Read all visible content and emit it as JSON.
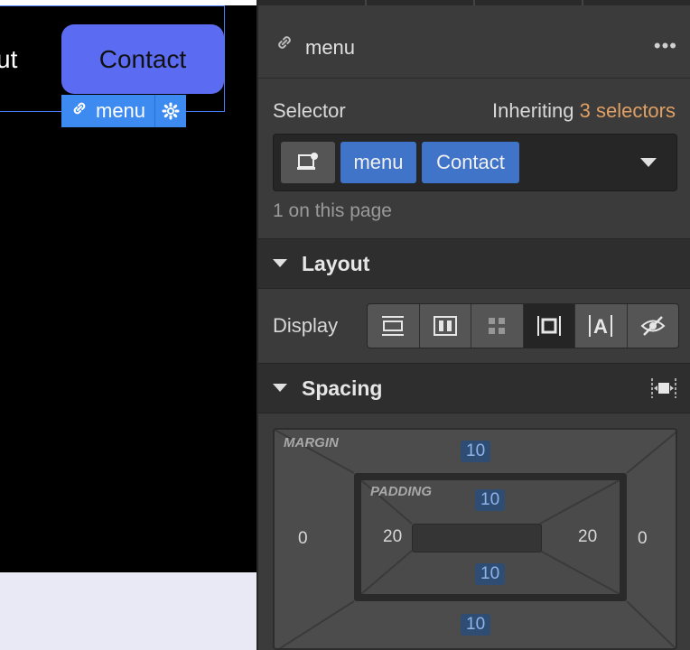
{
  "canvas": {
    "partial_nav_text": "ut",
    "contact_button": "Contact",
    "badge_label": "menu"
  },
  "header": {
    "title": "menu",
    "more": "•••"
  },
  "selector": {
    "label": "Selector",
    "inheriting_prefix": "Inheriting",
    "inheriting_count": "3 selectors",
    "chips": [
      "menu",
      "Contact"
    ],
    "count_text": "1 on this page"
  },
  "layout": {
    "title": "Layout",
    "display_label": "Display",
    "display_options": [
      "block",
      "flex",
      "grid",
      "inline-block",
      "inline",
      "none"
    ],
    "active": "inline-block"
  },
  "spacing": {
    "title": "Spacing",
    "margin_label": "MARGIN",
    "padding_label": "PADDING",
    "margin": {
      "top": "10",
      "right": "0",
      "bottom": "10",
      "left": "0"
    },
    "padding": {
      "top": "10",
      "right": "20",
      "bottom": "10",
      "left": "20"
    }
  },
  "colors": {
    "accent_orange": "#e0a064",
    "selection_blue": "#3d8bf0",
    "button_purple": "#5b6cf2"
  }
}
